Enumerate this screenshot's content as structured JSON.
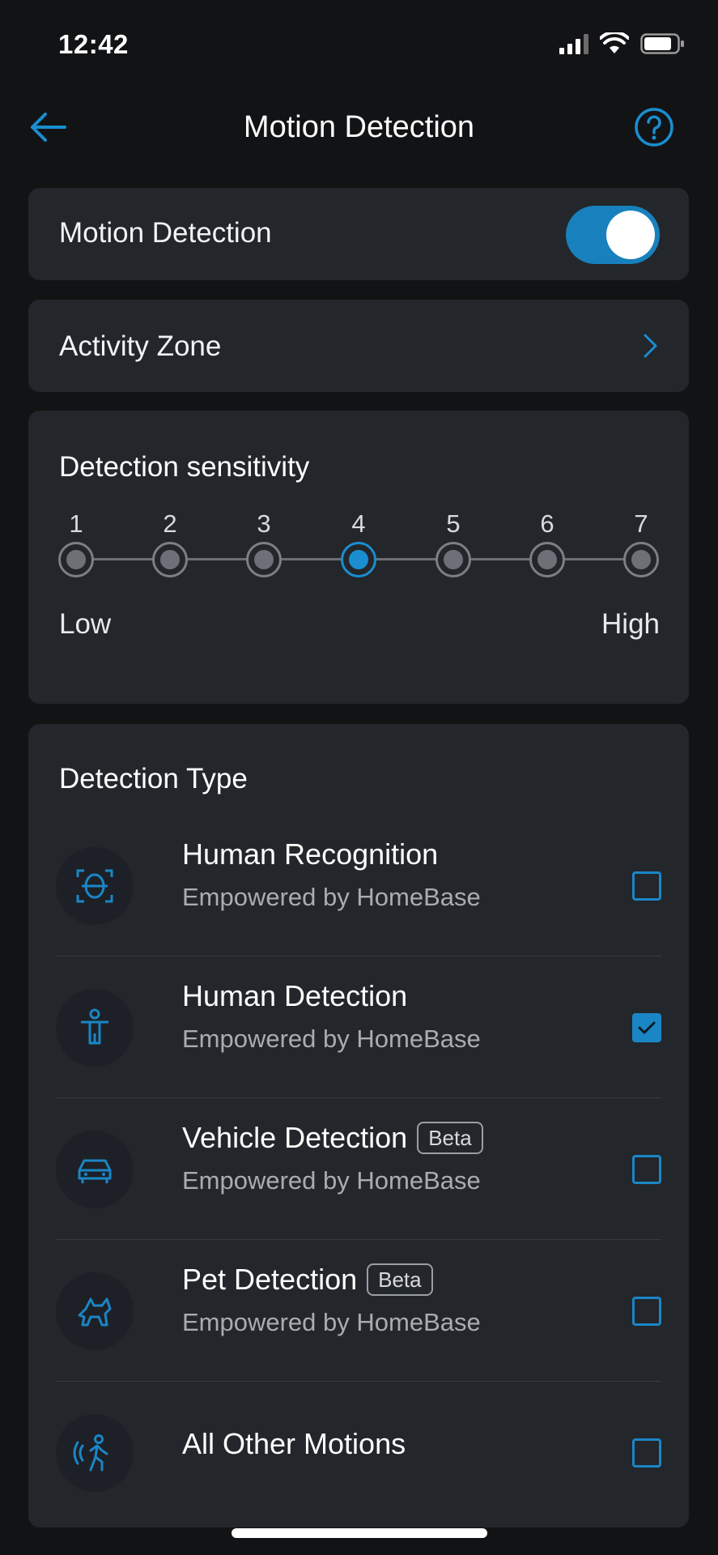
{
  "status_bar": {
    "time": "12:42"
  },
  "header": {
    "title": "Motion Detection"
  },
  "motion_detection": {
    "label": "Motion Detection",
    "enabled": true
  },
  "activity_zone": {
    "label": "Activity Zone"
  },
  "sensitivity": {
    "title": "Detection sensitivity",
    "levels": [
      "1",
      "2",
      "3",
      "4",
      "5",
      "6",
      "7"
    ],
    "selected": 4,
    "low_label": "Low",
    "high_label": "High"
  },
  "detection_type": {
    "title": "Detection Type",
    "items": [
      {
        "name": "Human Recognition",
        "subtitle": "Empowered by HomeBase",
        "checked": false,
        "icon": "face-scan-icon"
      },
      {
        "name": "Human Detection",
        "subtitle": "Empowered by HomeBase",
        "checked": true,
        "icon": "person-icon"
      },
      {
        "name": "Vehicle Detection",
        "badge": "Beta",
        "subtitle": "Empowered by HomeBase",
        "checked": false,
        "icon": "car-icon"
      },
      {
        "name": "Pet Detection",
        "badge": "Beta",
        "subtitle": "Empowered by HomeBase",
        "checked": false,
        "icon": "pet-icon"
      },
      {
        "name": "All Other Motions",
        "checked": false,
        "icon": "motion-person-icon"
      }
    ]
  },
  "colors": {
    "accent": "#1880bd",
    "background": "#121315",
    "card": "#23262a"
  }
}
